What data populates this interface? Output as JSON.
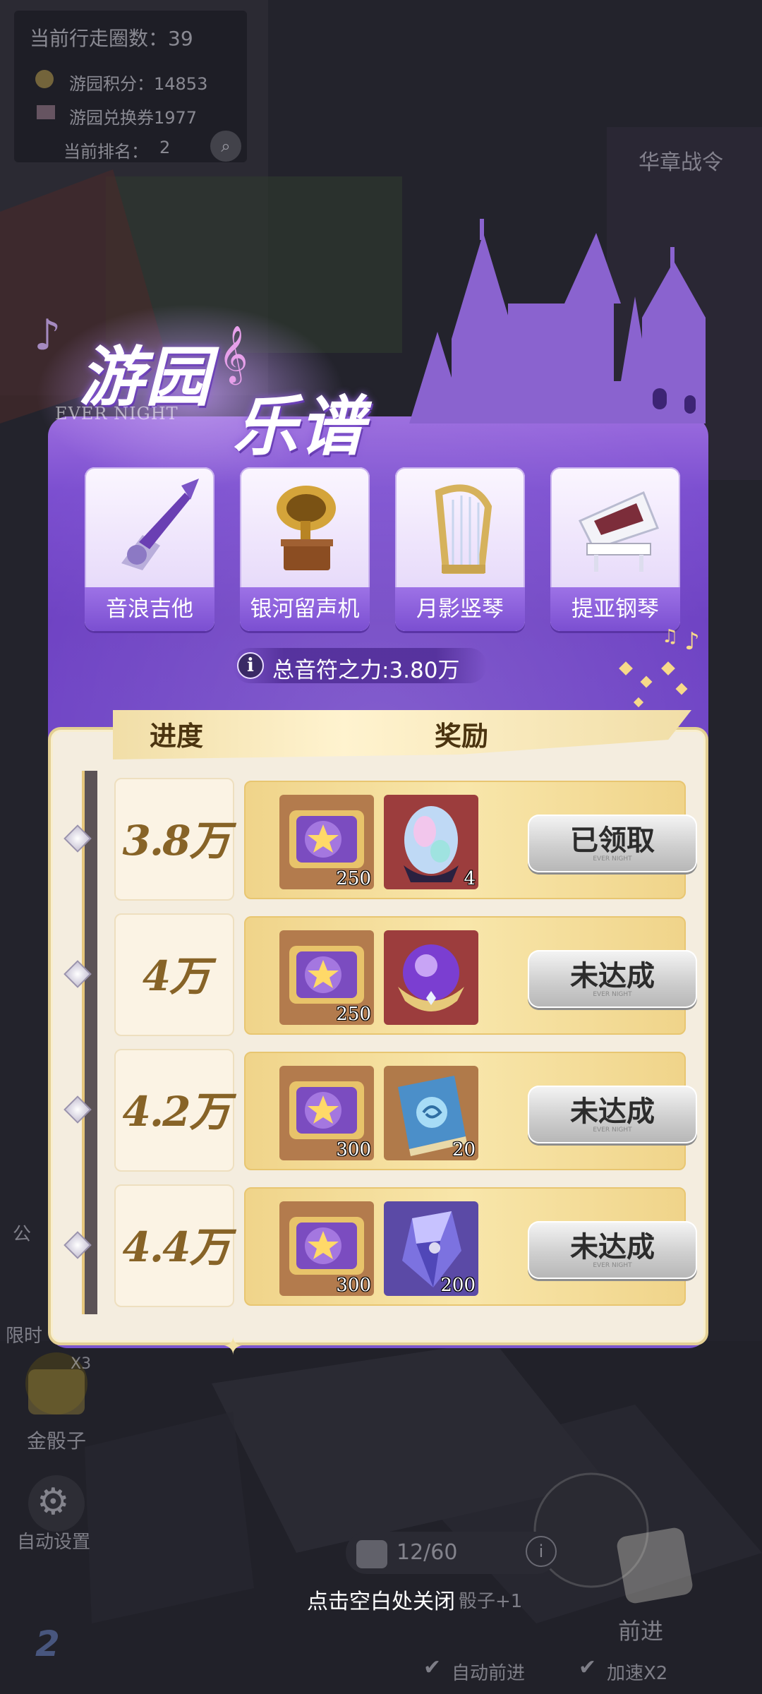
{
  "hud": {
    "laps": "当前行走圈数：39",
    "points": "游园积分：14853",
    "coupons": "游园兑换券1977",
    "rank": "当前排名：",
    "rank_value": "2"
  },
  "background": {
    "side_right_1": "华章战令",
    "side_left_1": "公",
    "side_left_2": "限时",
    "dice_gold": "金骰子",
    "dice_gold_mult": "X3",
    "auto_settings": "自动设置",
    "dice_count": "12/60",
    "dice_plus": "骰子+1",
    "go": "前进",
    "auto_go": "自动前进",
    "speed": "加速X2"
  },
  "panel": {
    "title_line1": "游园",
    "title_line2": "乐谱",
    "logo_sub": "EVER NIGHT",
    "instruments": [
      {
        "label": "音浪吉他",
        "icon": "guitar-icon"
      },
      {
        "label": "银河留声机",
        "icon": "gramophone-icon"
      },
      {
        "label": "月影竖琴",
        "icon": "harp-icon"
      },
      {
        "label": "提亚钢琴",
        "icon": "piano-icon"
      }
    ],
    "power_icon": "i",
    "power": "总音符之力:3.80万",
    "header_progress": "进度",
    "header_reward": "奖励",
    "button_sub": "EVER NIGHT",
    "rows": [
      {
        "threshold": "3.8万",
        "reward1_count": "250",
        "reward2_count": "4",
        "reward2_icon": "opal-egg-icon",
        "button": "已领取",
        "button_state": "claimed"
      },
      {
        "threshold": "4万",
        "reward1_count": "250",
        "reward2_count": "",
        "reward2_icon": "purple-orb-icon",
        "button": "未达成",
        "button_state": "locked"
      },
      {
        "threshold": "4.2万",
        "reward1_count": "300",
        "reward2_count": "20",
        "reward2_icon": "spell-book-icon",
        "button": "未达成",
        "button_state": "locked"
      },
      {
        "threshold": "4.4万",
        "reward1_count": "300",
        "reward2_count": "200",
        "reward2_icon": "crystal-icon",
        "button": "未达成",
        "button_state": "locked"
      }
    ]
  },
  "close_hint": "点击空白处关闭",
  "colors": {
    "panel_purple": "#6c3fc2",
    "gold": "#f0d48a",
    "sheet": "#f4eddf"
  }
}
